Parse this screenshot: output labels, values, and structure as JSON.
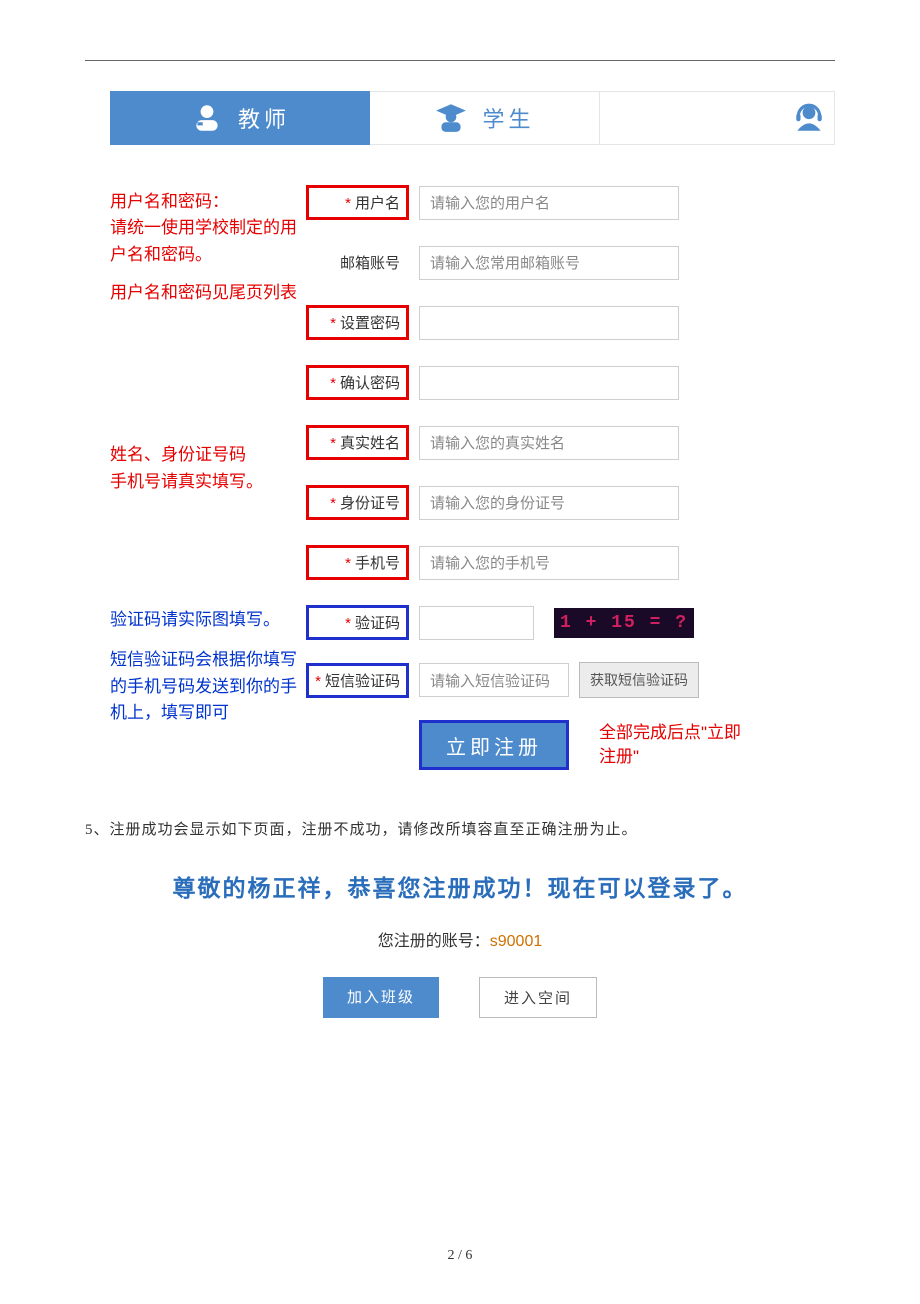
{
  "tabs": {
    "teacher": "教师",
    "student": "学生"
  },
  "notes": {
    "userpass1": "用户名和密码：",
    "userpass2": "请统一使用学校制定的用户名和密码。",
    "userpass3": "用户名和密码见尾页列表",
    "realinfo1": "姓名、身份证号码",
    "realinfo2": "手机号请真实填写。",
    "captcha": "验证码请实际图填写。",
    "sms1": "短信验证码会根据你填写的手机号码发送到你的手机上，填写即可"
  },
  "fields": {
    "username_label": "用户名",
    "username_ph": "请输入您的用户名",
    "email_label": "邮箱账号",
    "email_ph": "请输入您常用邮箱账号",
    "setpass_label": "设置密码",
    "confirmpass_label": "确认密码",
    "realname_label": "真实姓名",
    "realname_ph": "请输入您的真实姓名",
    "idnum_label": "身份证号",
    "idnum_ph": "请输入您的身份证号",
    "phone_label": "手机号",
    "phone_ph": "请输入您的手机号",
    "captcha_label": "验证码",
    "captcha_img": "1  + 15 = ?",
    "sms_label": "短信验证码",
    "sms_ph": "请输入短信验证码",
    "sms_btn": "获取短信验证码",
    "submit": "立即注册",
    "submit_note": "全部完成后点\"立即注册\""
  },
  "step5": "5、注册成功会显示如下页面，注册不成功，请修改所填容直至正确注册为止。",
  "success": {
    "title": "尊敬的杨正祥，恭喜您注册成功！现在可以登录了。",
    "account_label": "您注册的账号：",
    "account_value": "s90001",
    "btn_join": "加入班级",
    "btn_space": "进入空间"
  },
  "page_num": "2 / 6"
}
